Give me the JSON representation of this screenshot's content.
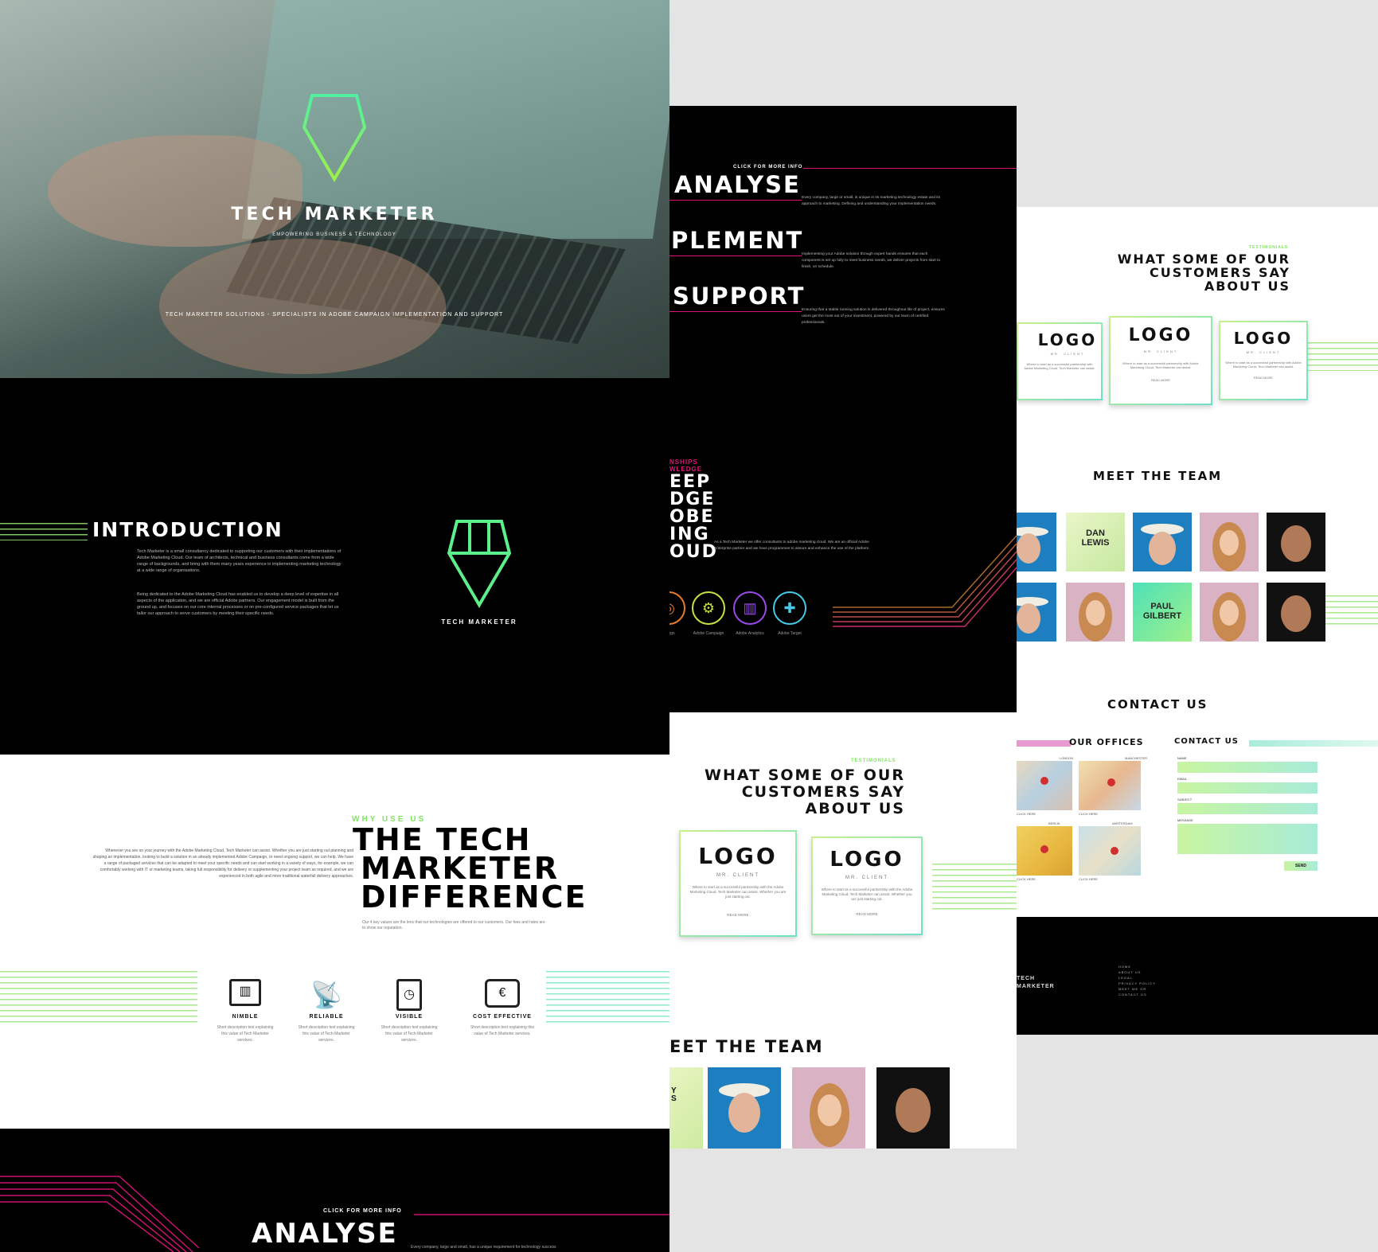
{
  "hero": {
    "brand": "TECH MARKETER",
    "tagline": "EMPOWERING BUSINESS & TECHNOLOGY",
    "strapline": "TECH MARKETER SOLUTIONS - SPECIALISTS IN ADOBE CAMPAIGN IMPLEMENTATION AND SUPPORT"
  },
  "intro": {
    "heading": "INTRODUCTION",
    "para1": "Tech Marketer is a small consultancy dedicated to supporting our customers with their implementations of Adobe Marketing Cloud. Our team of architects, technical and business consultants come from a wide range of backgrounds, and bring with them many years experience in implementing marketing technology at a wide range of organisations.",
    "para2": "Being dedicated to the Adobe Marketing Cloud has enabled us to develop a deep level of expertise in all aspects of the application, and we are official Adobe partners. Our engagement model is built from the ground up, and focuses on our core internal processes or on pre-configured service packages that let us tailor our approach to serve customers by meeting their specific needs.",
    "logo_caption": "TECH MARKETER"
  },
  "why": {
    "kicker": "WHY USE US",
    "title1": "THE TECH",
    "title2": "MARKETER",
    "title3": "DIFFERENCE",
    "body": "Whenever you are on your journey with the Adobe Marketing Cloud, Tech Marketer can assist. Whether you are just starting out planning and shaping an implementation, looking to build a solution in an already implemented Adobe Campaign, or need ongoing support, we can help. We have a range of packaged services that can be adapted to meet your specific needs and can start working in a variety of ways, for example, we can comfortably working with IT or marketing teams, taking full responsibility for delivery or supplementing your project team as required, and we are experienced in both agile and more traditional waterfall delivery approaches.",
    "sub": "Our 4 key values are the lens that our technologies are offered to our customers. Our fees and rates are to show our reputation.",
    "features": [
      {
        "label": "NIMBLE",
        "icon": "laptop-chart-icon"
      },
      {
        "label": "RELIABLE",
        "icon": "satellite-dish-icon"
      },
      {
        "label": "VISIBLE",
        "icon": "document-clock-icon"
      },
      {
        "label": "COST EFFECTIVE",
        "icon": "money-stack-icon"
      }
    ],
    "feature_text": "Short description text explaining this value of Tech Marketer services."
  },
  "analyse_bottom": {
    "kicker": "CLICK FOR MORE INFO",
    "title": "ANALYSE",
    "text": "Every company, large and small, has a unique requirement for technology success"
  },
  "mid": {
    "kicker": "CLICK FOR MORE INFO",
    "items": [
      {
        "title": "ANALYSE",
        "text": "Every company, large or small, is unique in its marketing technology estate and its approach to marketing. Defining and understanding your implementation needs."
      },
      {
        "title": "PLEMENT",
        "text": "Implementing your Adobe solution through expert hands ensures that each component is set up fully to meet business needs, we deliver projects from start to finish, on schedule."
      },
      {
        "title": "SUPPORT",
        "text": "Ensuring that a stable running solution is delivered throughout life of project, ensures users get the most out of your investment, powered by our team of certified professionals."
      }
    ],
    "pink_label1": "NSHIPS",
    "pink_label2": "WLEDGE",
    "big_words": [
      "EEP",
      "DGE",
      "OBE",
      "ING",
      "OUD"
    ],
    "cloud_text": "As a Tech Marketer we offer consultants to adobe marketing cloud. We are an official Adobe Enterprise partner and we have programmes to assure and enhance the use of the platform.",
    "cloud_icons": [
      {
        "label": "Adobe Campaign",
        "icon": "campaign-icon"
      },
      {
        "label": "Adobe Analytics",
        "icon": "analytics-icon"
      },
      {
        "label": "Adobe Target",
        "icon": "target-icon"
      }
    ],
    "cloud_icon_label_cut": "ign",
    "testi_kicker": "TESTIMONIALS",
    "testi_title": [
      "WHAT SOME OF OUR",
      "CUSTOMERS SAY",
      "ABOUT US"
    ],
    "logo": "LOGO",
    "logo_sub": "MR. CLIENT",
    "logo_text": "Where to start as a successful partnership with the Adobe Marketing Cloud, Tech Marketer can assist. Whether you are just starting out.",
    "logo_link": "READ MORE",
    "team_title": "EET THE TEAM",
    "team_partial": [
      "Y",
      "S"
    ]
  },
  "right": {
    "testi_kicker": "TESTIMONIALS",
    "testi_title": [
      "WHAT SOME OF OUR",
      "CUSTOMERS SAY",
      "ABOUT US"
    ],
    "logo": "LOGO",
    "logo_sub": "MR. CLIENT",
    "logo_text": "Where to start as a successful partnership with Adobe Marketing Cloud, Tech Marketer can assist.",
    "logo_link": "READ MORE",
    "team_title": "MEET THE TEAM",
    "team_names": [
      [
        "DAN",
        "LEWIS"
      ],
      [
        "PAUL",
        "GILBERT"
      ]
    ],
    "contact_title": "CONTACT US",
    "offices_title": "OUR OFFICES",
    "offices": [
      {
        "name": "LONDON",
        "sub": "CLICK HERE"
      },
      {
        "name": "MANCHESTER",
        "sub": "CLICK HERE"
      },
      {
        "name": "BERLIN",
        "sub": "CLICK HERE"
      },
      {
        "name": "AMSTERDAM",
        "sub": "CLICK HERE"
      }
    ],
    "form_title": "CONTACT US",
    "form_fields": [
      "NAME",
      "EMAIL",
      "SUBJECT",
      "MESSAGE"
    ],
    "send": "SEND",
    "footer_brand1": "TECH",
    "footer_brand2": "MARKETER",
    "footer_links": [
      "HOME",
      "ABOUT US",
      "LEGAL",
      "PRIVACY POLICY",
      "MEET ME OR",
      "CONTACT US"
    ]
  },
  "colors": {
    "green": "#7ee85c",
    "teal": "#5ee0c8",
    "pink": "#e0147a",
    "dark": "#000000"
  }
}
